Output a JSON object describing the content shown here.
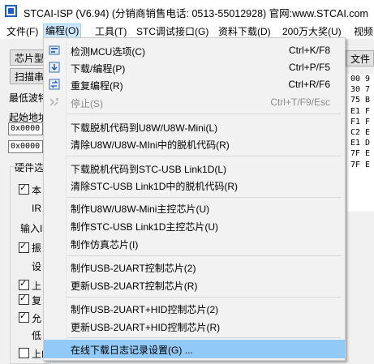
{
  "window": {
    "title": "STCAI-ISP (V6.94) (分销商销售电话: 0513-55012928) 官网:www.STCAI.com",
    "title_suffix": "—"
  },
  "menubar": [
    {
      "label": "文件(F)"
    },
    {
      "label": "编程(O)"
    },
    {
      "label": "工具(T)"
    },
    {
      "label": "STC调试接口(G)"
    },
    {
      "label": "资料下载(D)"
    },
    {
      "label": "200万大奖(U)"
    },
    {
      "label": "视频"
    }
  ],
  "background": {
    "chip_button": "芯片型",
    "scan_button": "扫描串",
    "file_button": "文件",
    "min_wave_label": "最低波特",
    "start_addr_label": "起始地址",
    "addr1_value": "0x0000",
    "addr2_value": "0x0000",
    "hw_options_label": "硬件选",
    "options": [
      {
        "text": "本",
        "checked": true
      },
      {
        "text": "IR",
        "checked": null
      },
      {
        "text": "输入I",
        "checked": null
      },
      {
        "text": "振",
        "checked": true
      },
      {
        "text": "设",
        "checked": null
      },
      {
        "text": "上",
        "checked": true
      },
      {
        "text": "复",
        "checked": true
      },
      {
        "text": "允",
        "checked": true
      },
      {
        "text": "低",
        "checked": null
      },
      {
        "text": "上I",
        "checked": false
      }
    ],
    "hex_lines": [
      "00 9",
      "30 7",
      "75 B",
      "E1 F",
      "F1 F",
      "C2 E",
      "E1 D",
      "7F E",
      "7F E"
    ]
  },
  "dropdown": {
    "items": [
      {
        "type": "item",
        "label": "检测MCU选项(C)",
        "shortcut": "Ctrl+K/F8",
        "icon": "detect-icon",
        "disabled": false
      },
      {
        "type": "item",
        "label": "下载/编程(P)",
        "shortcut": "Ctrl+P/F5",
        "icon": "download-icon",
        "disabled": false
      },
      {
        "type": "item",
        "label": "重复编程(R)",
        "shortcut": "Ctrl+R/F6",
        "icon": "repeat-icon",
        "disabled": false
      },
      {
        "type": "item",
        "label": "停止(S)",
        "shortcut": "Ctrl+T/F9/Esc",
        "icon": "stop-icon",
        "disabled": true
      },
      {
        "type": "sep"
      },
      {
        "type": "item",
        "label": "下载脱机代码到U8W/U8W-Mini(L)",
        "shortcut": "",
        "disabled": false
      },
      {
        "type": "item",
        "label": "清除U8W/U8W-MIni中的脱机代码(R)",
        "shortcut": "",
        "disabled": false
      },
      {
        "type": "sep"
      },
      {
        "type": "item",
        "label": "下载脱机代码到STC-USB Link1D(L)",
        "shortcut": "",
        "disabled": false
      },
      {
        "type": "item",
        "label": "清除STC-USB Link1D中的脱机代码(R)",
        "shortcut": "",
        "disabled": false
      },
      {
        "type": "sep"
      },
      {
        "type": "item",
        "label": "制作U8W/U8W-Mini主控芯片(U)",
        "shortcut": "",
        "disabled": false
      },
      {
        "type": "item",
        "label": "制作STC-USB Link1D主控芯片(U)",
        "shortcut": "",
        "disabled": false
      },
      {
        "type": "item",
        "label": "制作仿真芯片(I)",
        "shortcut": "",
        "disabled": false
      },
      {
        "type": "sep"
      },
      {
        "type": "item",
        "label": "制作USB-2UART控制芯片(2)",
        "shortcut": "",
        "disabled": false
      },
      {
        "type": "item",
        "label": "更新USB-2UART控制芯片(R)",
        "shortcut": "",
        "disabled": false
      },
      {
        "type": "sep"
      },
      {
        "type": "item",
        "label": "制作USB-2UART+HID控制芯片(2)",
        "shortcut": "",
        "disabled": false
      },
      {
        "type": "item",
        "label": "更新USB-2UART+HID控制芯片(R)",
        "shortcut": "",
        "disabled": false
      },
      {
        "type": "sep"
      },
      {
        "type": "item",
        "label": "在线下载日志记录设置(G) ...",
        "shortcut": "",
        "disabled": false,
        "hover": true
      }
    ]
  },
  "colors": {
    "menu_hover": "#91c9f7",
    "menubar_active": "#cce8ff",
    "disabled_text": "#8c8c8c"
  }
}
